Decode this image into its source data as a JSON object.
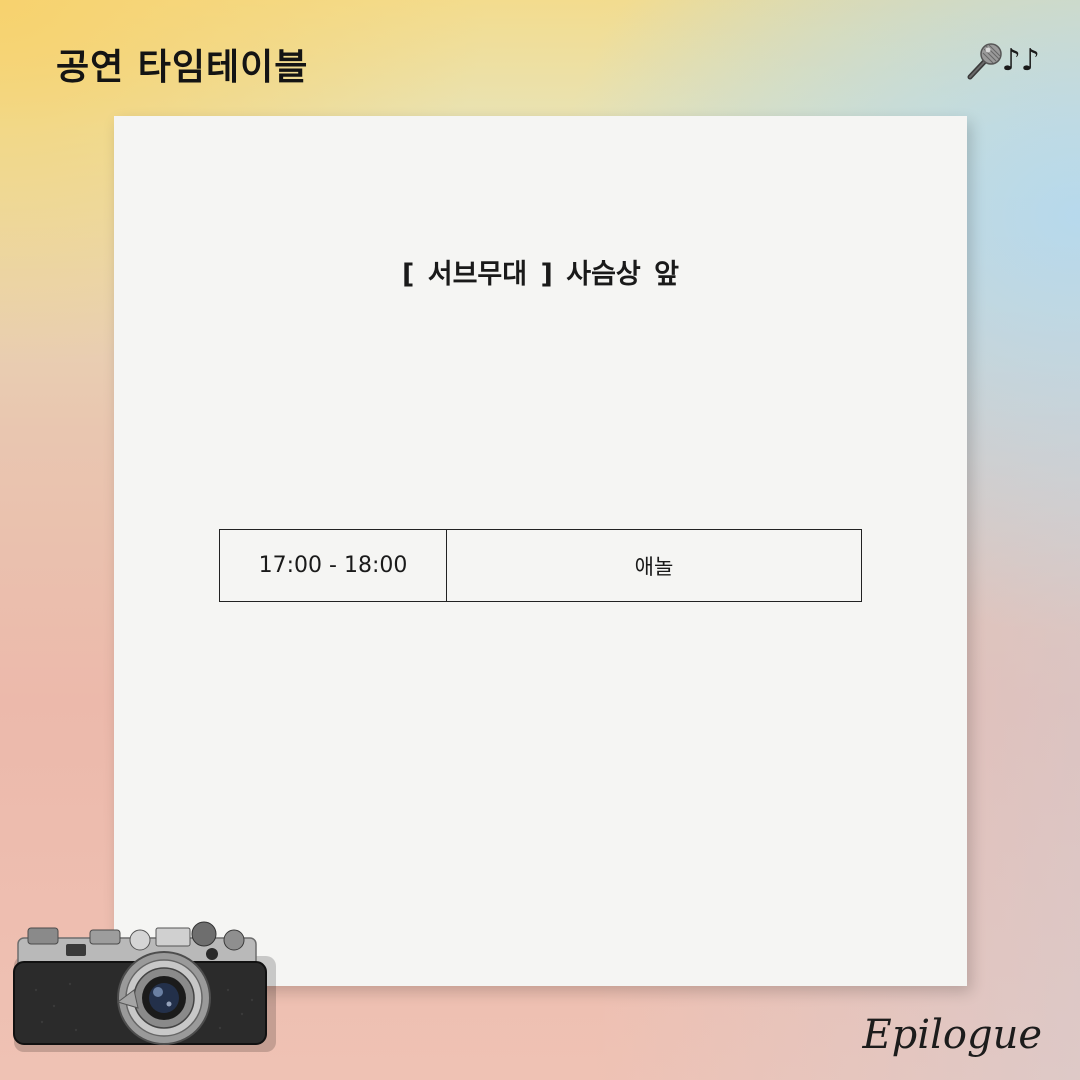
{
  "header": {
    "title": "공연 타임테이블",
    "notes_glyph": "♪♪"
  },
  "stage": {
    "venue": "[ 서브무대 ]  사슴상 앞"
  },
  "schedule": [
    {
      "time": "17:00 - 18:00",
      "performer": "애놀"
    }
  ],
  "footer": {
    "brand": "Epilogue"
  },
  "icons": {
    "header": [
      "microphone-icon",
      "music-notes-icon"
    ],
    "decoration": [
      "vintage-camera-icon"
    ]
  },
  "colors": {
    "title": "#141414",
    "paper": "#f5f5f3",
    "table_border": "#222222",
    "gradient_yellow": "#f3dc8e",
    "gradient_blue": "#b0daf0",
    "gradient_pink": "#ecb9ab"
  }
}
